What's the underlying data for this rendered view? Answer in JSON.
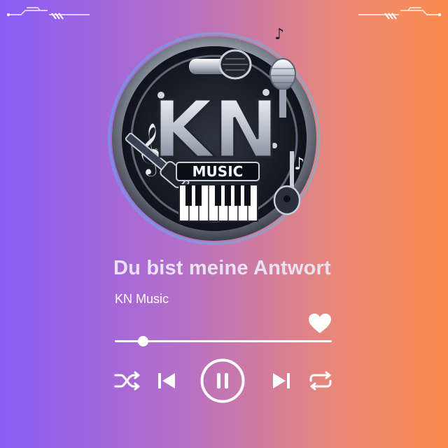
{
  "song": {
    "title": "Du bist meine Antwort",
    "artist": "KN Music"
  },
  "logo": {
    "main_text": "KN",
    "sub_text": "MUSIC"
  },
  "player": {
    "progress_fraction": 0.13,
    "liked": true
  },
  "colors": {
    "accent": "#ffffff",
    "gradient_left": "#8a5cf6",
    "gradient_right": "#fb8c4e"
  },
  "icons": {
    "like": "heart-icon",
    "shuffle": "shuffle-icon",
    "previous": "previous-icon",
    "pause": "pause-icon",
    "next": "next-icon",
    "repeat": "repeat-icon"
  }
}
